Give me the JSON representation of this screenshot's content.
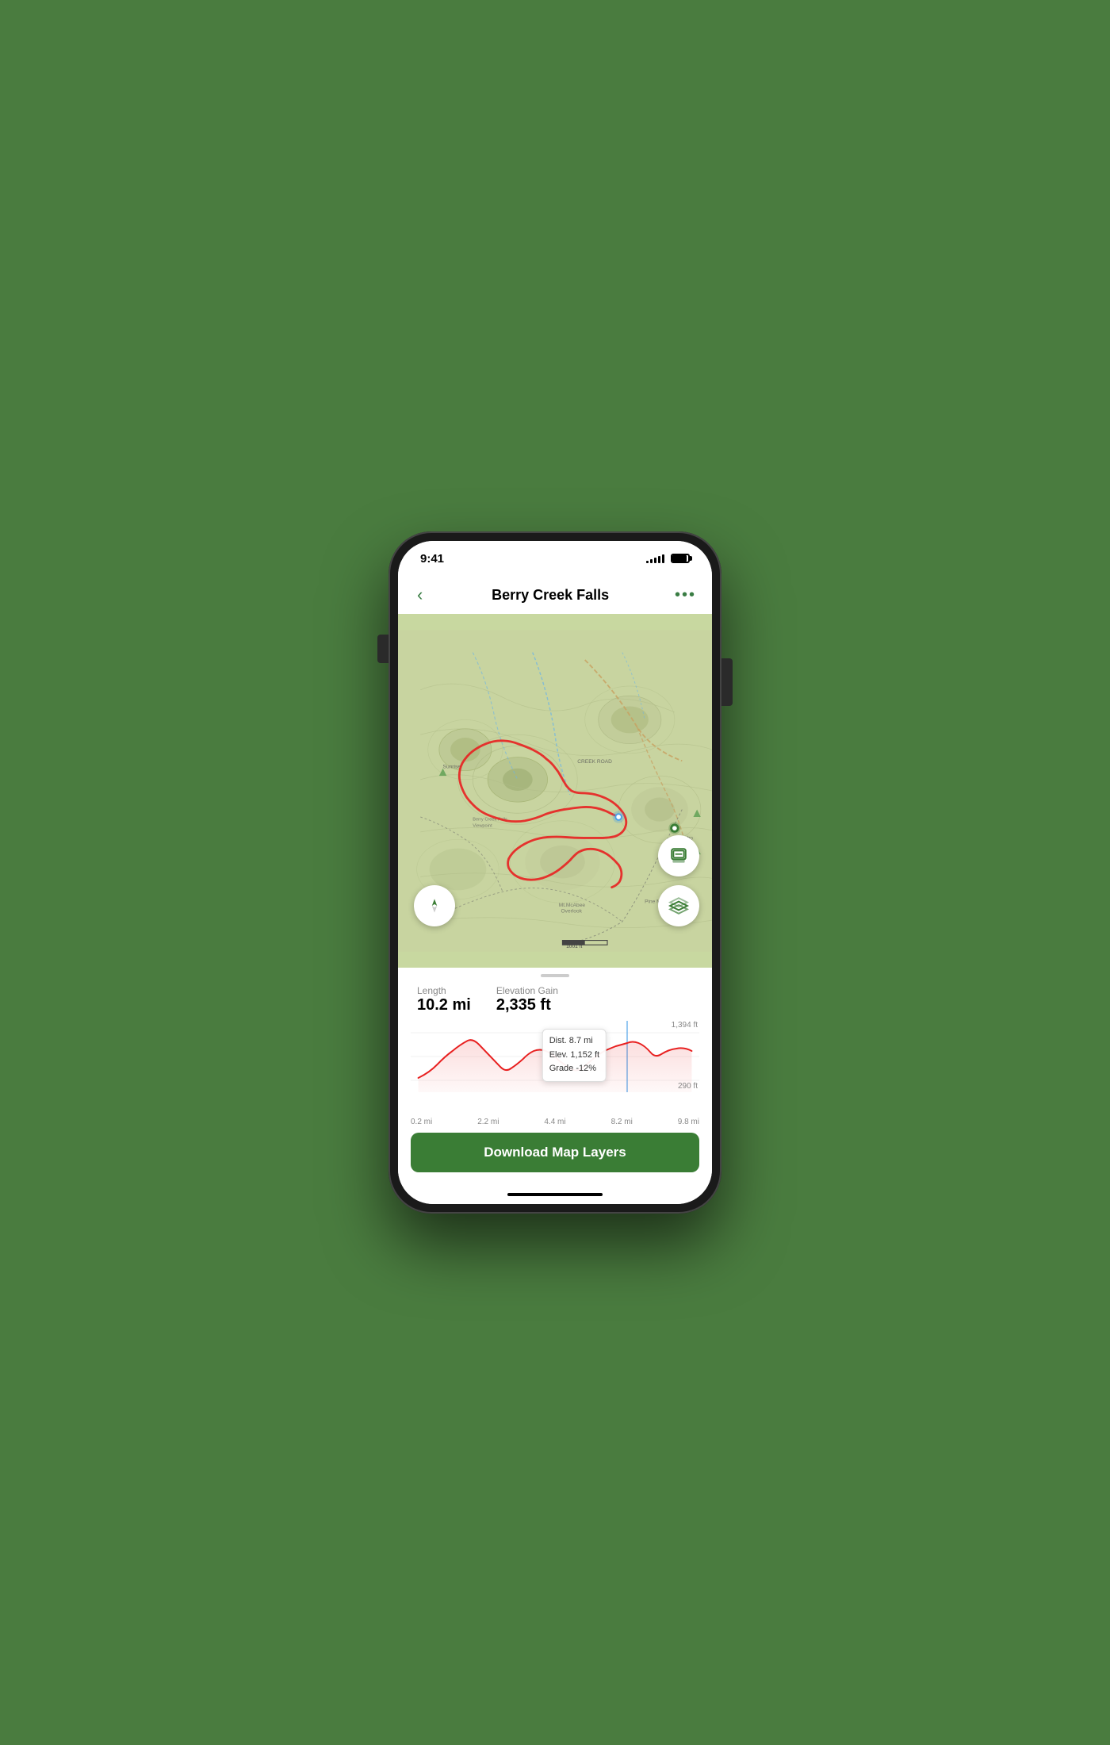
{
  "status": {
    "time": "9:41",
    "signal_bars": [
      3,
      5,
      7,
      9,
      11
    ],
    "battery_level": 75
  },
  "header": {
    "title": "Berry Creek Falls",
    "back_label": "‹",
    "more_label": "•••"
  },
  "map": {
    "layers_btn_label": "layers",
    "compass_btn_label": "compass",
    "layers_btn2_label": "layers2"
  },
  "stats": {
    "length_label": "Length",
    "length_value": "10.2 mi",
    "elevation_label": "Elevation Gain",
    "elevation_value": "2,335 ft"
  },
  "elevation_chart": {
    "y_max_label": "1,394 ft",
    "y_min_label": "290 ft",
    "x_labels": [
      "0.2 mi",
      "2.2 mi",
      "4.4 mi",
      "8.2 mi",
      "9.8 mi"
    ]
  },
  "tooltip": {
    "dist": "Dist. 8.7 mi",
    "elev": "Elev. 1,152 ft",
    "grade": "Grade -12%"
  },
  "download_button": {
    "label": "Download Map Layers"
  }
}
